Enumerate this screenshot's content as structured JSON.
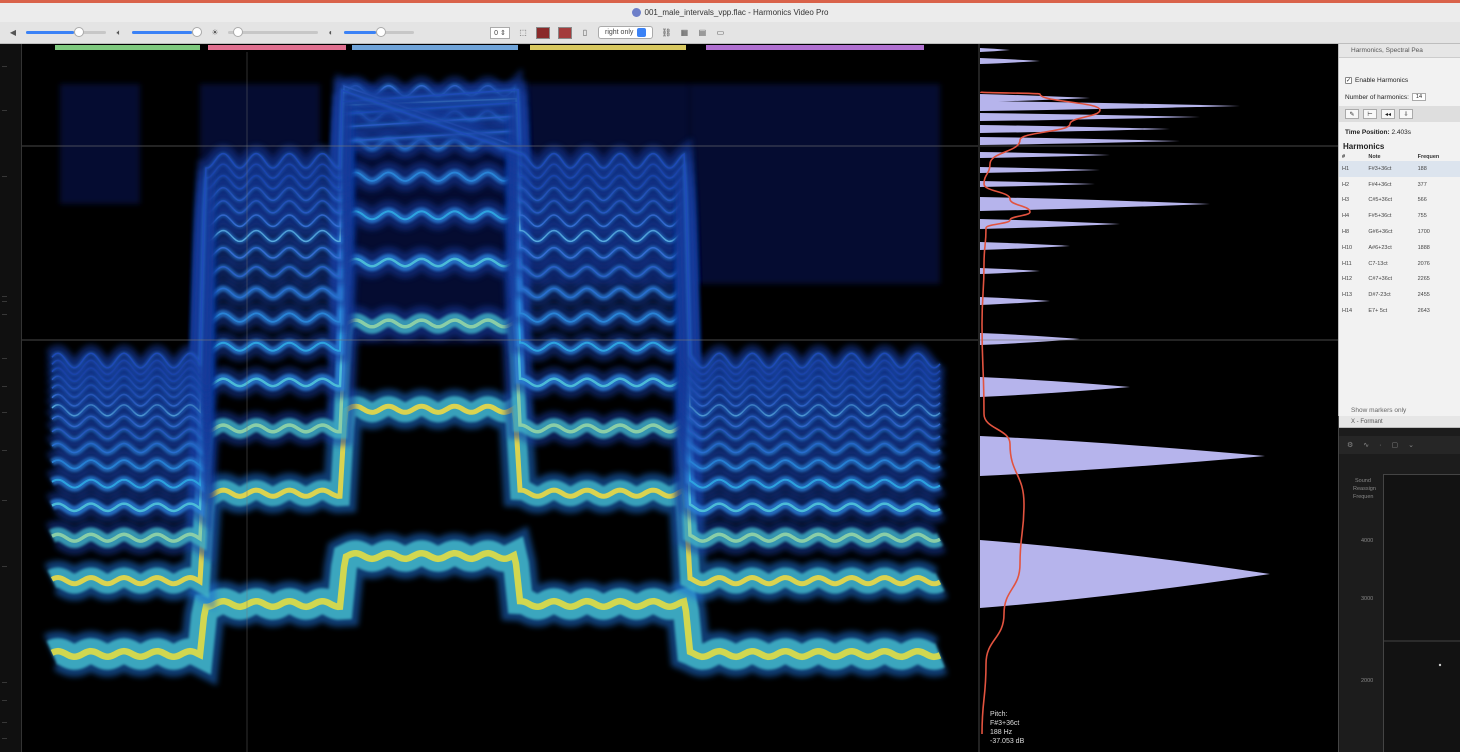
{
  "window": {
    "title": "001_male_intervals_vpp.flac - Harmonics Video Pro"
  },
  "toolbar": {
    "view_mode": "right only",
    "icons": [
      "speaker-icon",
      "brightness-icon",
      "contrast-icon",
      "color-swatch-icon",
      "color-swatch-icon",
      "layout-icon",
      "grid-icon"
    ],
    "colors": {
      "accent": "#3b82f6",
      "swatch_dark": "#8a2a2a",
      "swatch_red": "#a33c3c"
    }
  },
  "spectrogram": {
    "region_colors": [
      "#7fc97f",
      "#e07090",
      "#6fa3d8",
      "#d8c860",
      "#b070d0"
    ]
  },
  "spectrum": {
    "readout_label": "Pitch:",
    "readout_note": "F#3+36ct",
    "readout_freq": "188 Hz",
    "readout_db": "-37.053 dB",
    "colors": {
      "peaks": "#b6b4ec",
      "curve": "#e2533f"
    }
  },
  "inspector": {
    "header": "Harmonics, Spectral Pea",
    "enable_harmonics": "Enable Harmonics",
    "number_of_harmonics_label": "Number of harmonics:",
    "number_of_harmonics_value": "14",
    "time_position_label": "Time Position:",
    "time_position_value": "2.403s",
    "section": "Harmonics",
    "columns": [
      "#",
      "Note",
      "Frequen"
    ],
    "rows": [
      {
        "n": "H1",
        "note": "F#3+36ct",
        "freq": "188"
      },
      {
        "n": "H2",
        "note": "F#4+36ct",
        "freq": "377"
      },
      {
        "n": "H3",
        "note": "C#5+36ct",
        "freq": "566"
      },
      {
        "n": "H4",
        "note": "F#5+36ct",
        "freq": "755"
      },
      {
        "n": "H8",
        "note": "G#6+36ct",
        "freq": "1700"
      },
      {
        "n": "H10",
        "note": "A#6+23ct",
        "freq": "1888"
      },
      {
        "n": "H11",
        "note": "C7-13ct",
        "freq": "2076"
      },
      {
        "n": "H12",
        "note": "C#7+36ct",
        "freq": "2265"
      },
      {
        "n": "H13",
        "note": "D#7-23ct",
        "freq": "2455"
      },
      {
        "n": "H14",
        "note": "E7+ 5ct",
        "freq": "2643"
      }
    ],
    "show_markers": "Show markers only"
  },
  "lower_panel": {
    "header": "X - Formant",
    "side_label_1": "Sound",
    "side_label_2": "Reassign",
    "side_label_3": "Frequen",
    "ticks": [
      "4000",
      "3000",
      "2000"
    ]
  }
}
